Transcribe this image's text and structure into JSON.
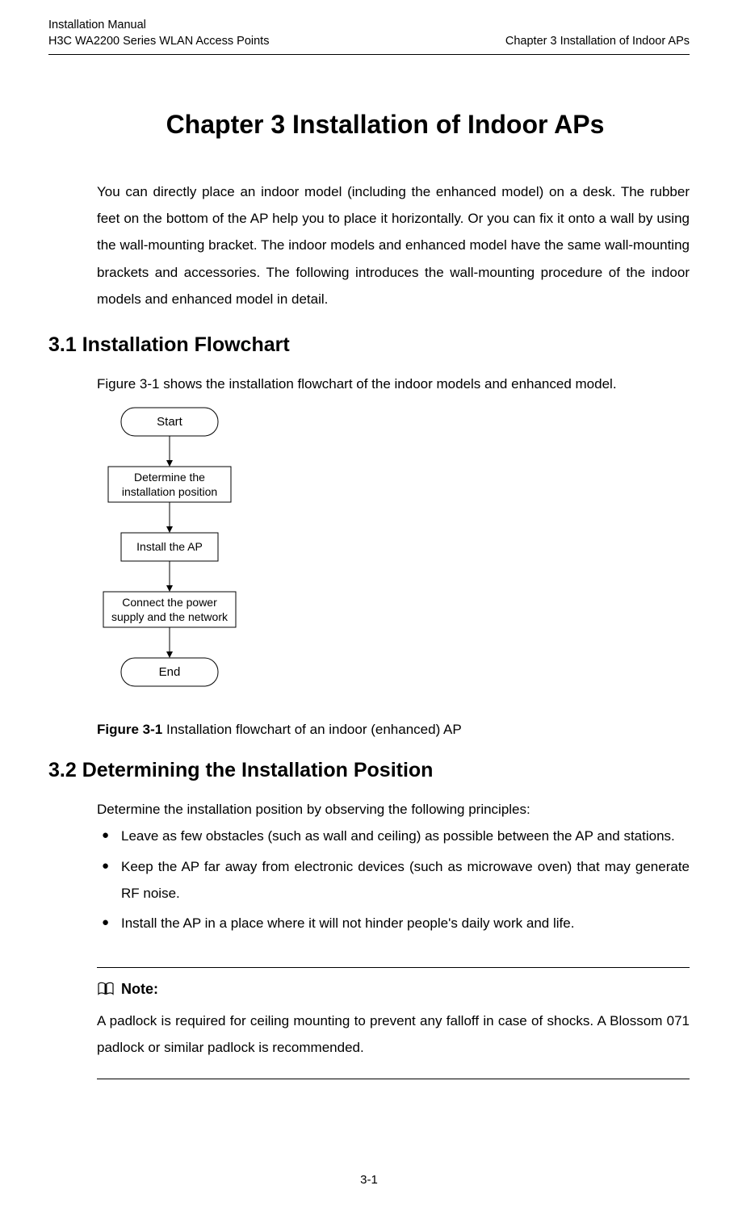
{
  "header": {
    "line1_left": "Installation Manual",
    "line2_left": "H3C WA2200 Series WLAN Access Points",
    "right": "Chapter 3  Installation of Indoor APs"
  },
  "chapter_title": "Chapter 3  Installation of Indoor APs",
  "intro_paragraph": "You can directly place an indoor model (including the enhanced model) on a desk. The rubber feet on the bottom of the AP help you to place it horizontally. Or you can fix it onto a wall by using the wall-mounting bracket. The indoor models and enhanced model have the same wall-mounting brackets and accessories. The following introduces the wall-mounting procedure of the indoor models and enhanced model in detail.",
  "section_3_1": {
    "heading": "3.1  Installation Flowchart",
    "reference": "Figure 3-1 shows the installation flowchart of the indoor models and enhanced model.",
    "flowchart_nodes": {
      "start": "Start",
      "step1": "Determine the installation position",
      "step2": "Install the AP",
      "step3": "Connect the power supply and the network",
      "end": "End"
    },
    "figure_label": "Figure 3-1",
    "figure_caption": " Installation flowchart of an indoor (enhanced) AP"
  },
  "section_3_2": {
    "heading": "3.2  Determining the Installation Position",
    "intro": "Determine the installation position by observing the following principles:",
    "bullets": [
      "Leave as few obstacles (such as wall and ceiling) as possible between the AP and stations.",
      "Keep the AP far away from electronic devices (such as microwave oven) that may generate RF noise.",
      "Install the AP in a place where it will not hinder people's daily work and life."
    ],
    "note_label": "Note:",
    "note_text": "A padlock is required for ceiling mounting to prevent any falloff in case of shocks. A Blossom 071 padlock or similar padlock is recommended."
  },
  "page_number": "3-1"
}
